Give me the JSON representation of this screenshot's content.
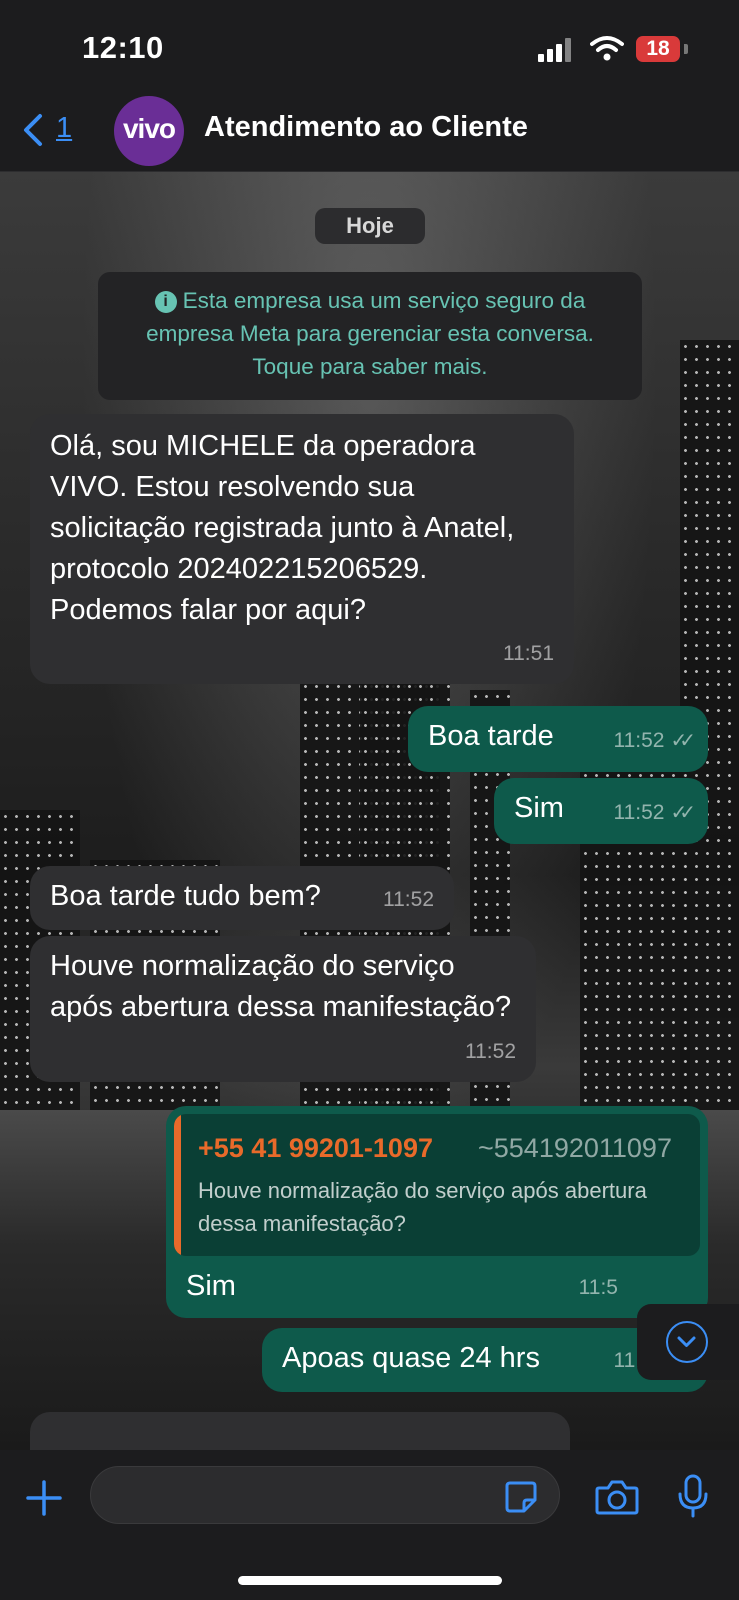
{
  "status_bar": {
    "time": "12:10",
    "battery": "18"
  },
  "header": {
    "back_count": "1",
    "avatar_text": "vivo",
    "contact_name": "Atendimento ao Cliente"
  },
  "chat": {
    "date_label": "Hoje",
    "info_text": "Esta empresa usa um serviço seguro da empresa Meta para gerenciar esta conversa. Toque para saber mais.",
    "messages": [
      {
        "direction": "incoming",
        "text": "Olá, sou MICHELE da operadora VIVO. Estou resolvendo sua solicitação registrada junto à Anatel, protocolo 202402215206529. Podemos falar por aqui?",
        "time": "11:51"
      },
      {
        "direction": "outgoing",
        "text": "Boa tarde",
        "time": "11:52",
        "status": "read"
      },
      {
        "direction": "outgoing",
        "text": "Sim",
        "time": "11:52",
        "status": "read"
      },
      {
        "direction": "incoming",
        "text": "Boa tarde tudo bem?",
        "time": "11:52"
      },
      {
        "direction": "incoming",
        "text": "Houve normalização do serviço após abertura dessa manifestação?",
        "time": "11:52"
      },
      {
        "direction": "outgoing",
        "text": "Sim",
        "time": "11:5",
        "status": "read",
        "quote": {
          "phone": "+55 41 99201-1097",
          "alias": "~554192011097",
          "text": "Houve normalização do serviço após abertura dessa manifestação?"
        }
      },
      {
        "direction": "outgoing",
        "text": "Apoas quase 24 hrs",
        "time": "11:52",
        "status": "read"
      }
    ]
  },
  "icons": {
    "back": "chevron-left-icon",
    "plus": "plus-icon",
    "sticker": "sticker-icon",
    "camera": "camera-icon",
    "mic": "microphone-icon",
    "scroll": "chevron-down-circle-icon",
    "info": "info-icon"
  },
  "colors": {
    "accent": "#3b8ef5",
    "outgoing": "#0e5a4b",
    "incoming": "#2f2f31",
    "info_text": "#67c3b3",
    "quote_name": "#e96a2a",
    "avatar": "#6a2e96"
  }
}
